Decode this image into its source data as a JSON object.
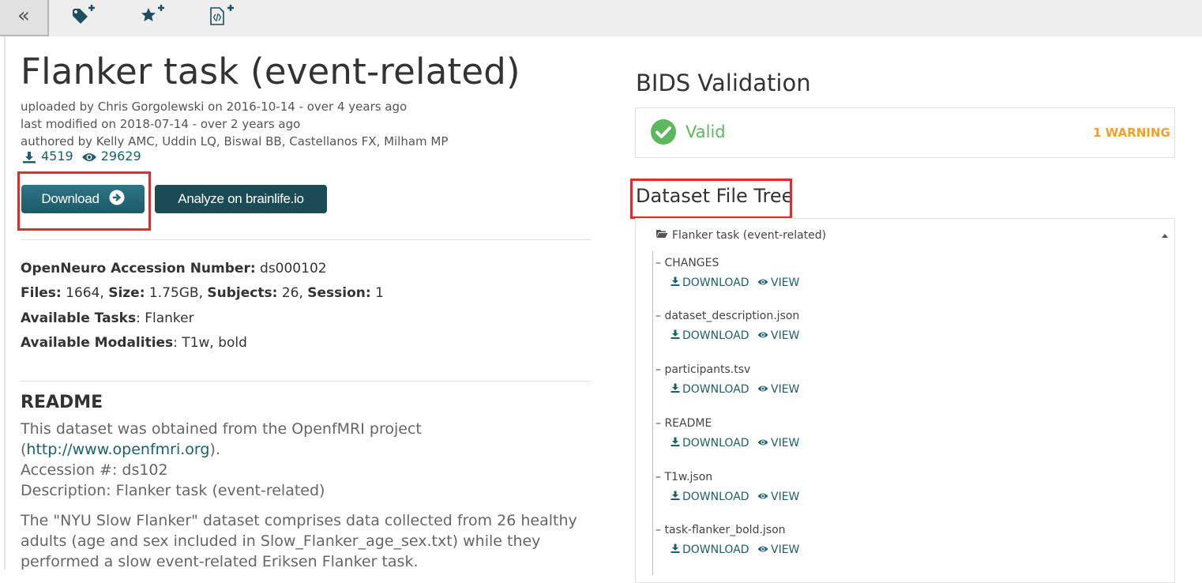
{
  "toolbar": {
    "collapse_glyph": "«",
    "icons": [
      "tag-plus-icon",
      "star-plus-icon",
      "code-file-plus-icon"
    ]
  },
  "dataset": {
    "title": "Flanker task (event-related)",
    "uploaded": "uploaded by Chris Gorgolewski on 2016-10-14 - over 4 years ago",
    "modified": "last modified on 2018-07-14 - over 2 years ago",
    "authored": "authored by Kelly AMC, Uddin LQ, Biswal BB, Castellanos FX, Milham MP",
    "downloads": "4519",
    "views": "29629"
  },
  "buttons": {
    "download": "Download",
    "analyze": "Analyze on brainlife.io"
  },
  "info": {
    "accession_label": "OpenNeuro Accession Number:",
    "accession_value": "ds000102",
    "files_label": "Files:",
    "files_value": "1664,",
    "size_label": "Size:",
    "size_value": "1.75GB,",
    "subjects_label": "Subjects:",
    "subjects_value": "26,",
    "session_label": "Session:",
    "session_value": "1",
    "tasks_label": "Available Tasks",
    "tasks_value": ": Flanker",
    "modalities_label": "Available Modalities",
    "modalities_value": ": T1w, bold"
  },
  "readme": {
    "heading": "README",
    "line1": "This dataset was obtained from the OpenfMRI project",
    "line2_open": "(",
    "line2_link": "http://www.openfmri.org",
    "line2_close": ").",
    "line3": "Accession #: ds102",
    "line4": "Description: Flanker task (event-related)",
    "line5": "The \"NYU Slow Flanker\" dataset comprises data collected from 26 healthy",
    "line6": "adults (age and sex included in Slow_Flanker_age_sex.txt) while they",
    "line7": "performed a slow event-related Eriksen Flanker task."
  },
  "validation": {
    "title": "BIDS Validation",
    "status": "Valid",
    "warnings": "1 WARNING",
    "status_color": "#5cb85c",
    "warning_color": "#f0a030"
  },
  "file_tree": {
    "title": "Dataset File Tree",
    "root": "Flanker task (event-related)",
    "download_label": "DOWNLOAD",
    "view_label": "VIEW",
    "files": [
      "CHANGES",
      "dataset_description.json",
      "participants.tsv",
      "README",
      "T1w.json",
      "task-flanker_bold.json"
    ]
  },
  "colors": {
    "accent": "#1c5f6e",
    "button_dark": "#1b4c55",
    "highlight_red": "#e02c2c"
  }
}
